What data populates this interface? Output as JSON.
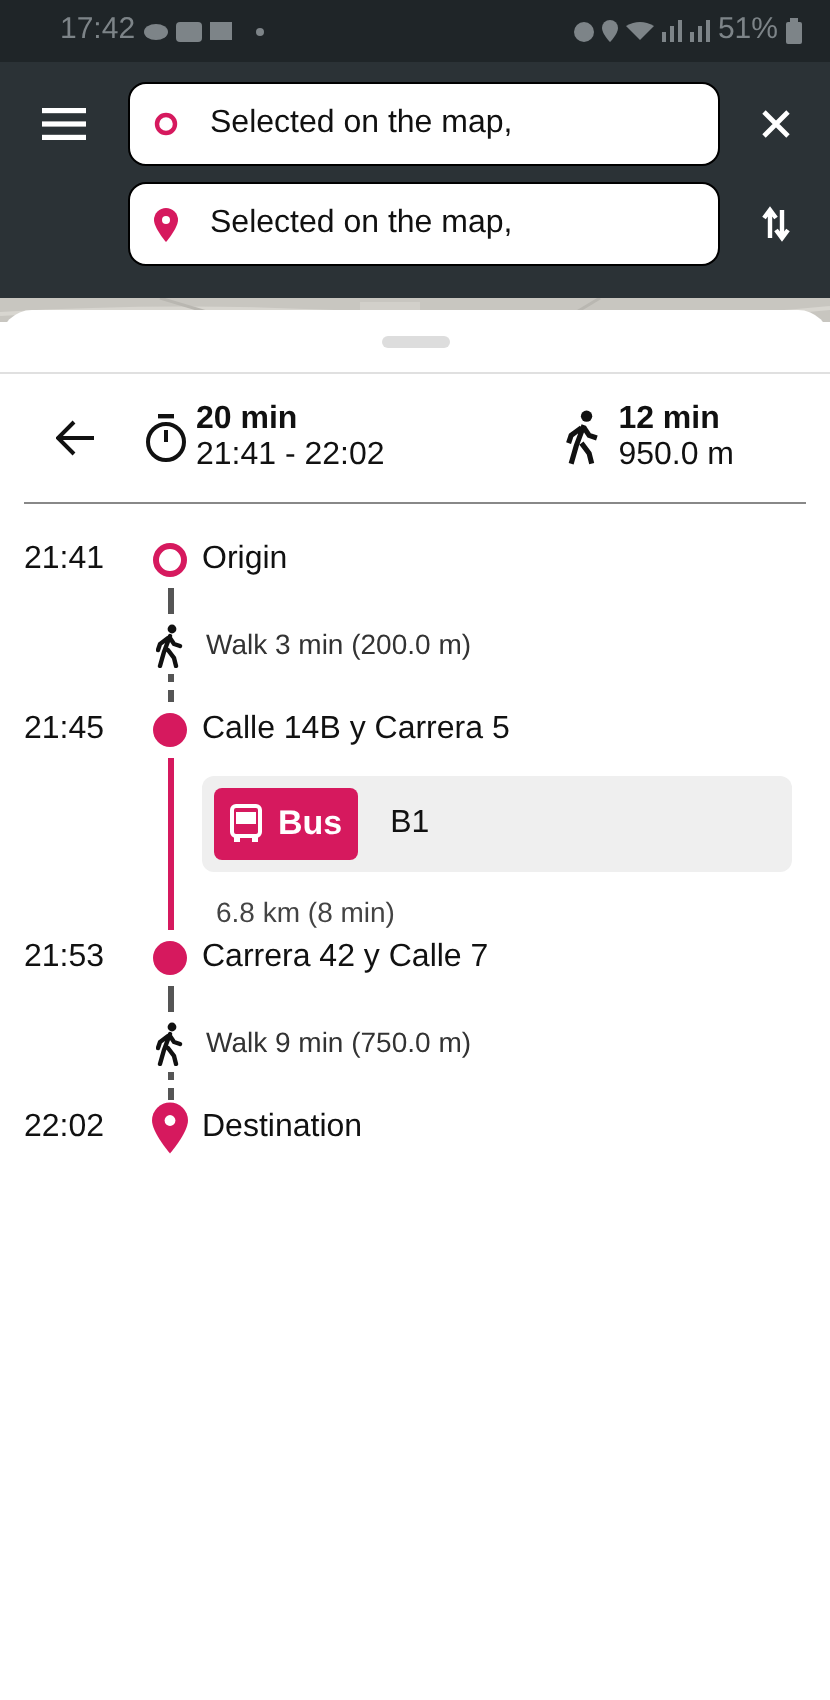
{
  "status_bar": {
    "time": "17:42",
    "battery": "51%"
  },
  "search": {
    "origin": {
      "value": "Selected on the map,"
    },
    "destination": {
      "value": "Selected on the map,"
    }
  },
  "summary": {
    "duration": "20 min",
    "time_range": "21:41 - 22:02",
    "walk_duration": "12 min",
    "walk_distance": "950.0 m"
  },
  "timeline": [
    {
      "kind": "origin",
      "time": "21:41",
      "name": "Origin"
    },
    {
      "kind": "walk",
      "text": "Walk 3 min (200.0 m)"
    },
    {
      "kind": "stop",
      "time": "21:45",
      "name": "Calle 14B y Carrera 5"
    },
    {
      "kind": "transit",
      "mode": "Bus",
      "route": "B1",
      "detail": "6.8 km (8 min)"
    },
    {
      "kind": "stop",
      "time": "21:53",
      "name": "Carrera 42 y Calle 7"
    },
    {
      "kind": "walk",
      "text": "Walk 9 min (750.0 m)"
    },
    {
      "kind": "destination",
      "time": "22:02",
      "name": "Destination"
    }
  ]
}
